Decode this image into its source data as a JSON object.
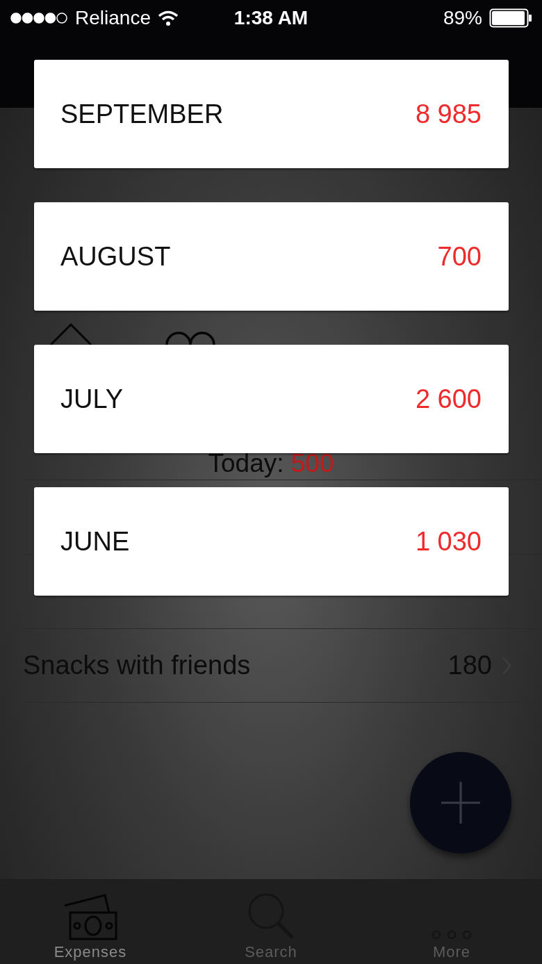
{
  "status_bar": {
    "carrier": "Reliance",
    "time": "1:38 AM",
    "battery": "89%"
  },
  "summary": {
    "today_label": "Today:",
    "today_value": "500"
  },
  "expenses": [
    {
      "title": "Snacks with friends",
      "amount": "180"
    }
  ],
  "tabs": [
    {
      "label": "Expenses",
      "kind": "money",
      "selected": true
    },
    {
      "label": "Search",
      "kind": "search",
      "selected": false
    },
    {
      "label": "More",
      "kind": "more",
      "selected": false
    }
  ],
  "month_picker": [
    {
      "month": "SEPTEMBER",
      "total": "8 985"
    },
    {
      "month": "AUGUST",
      "total": "700"
    },
    {
      "month": "JULY",
      "total": "2 600"
    },
    {
      "month": "JUNE",
      "total": "1 030"
    }
  ]
}
